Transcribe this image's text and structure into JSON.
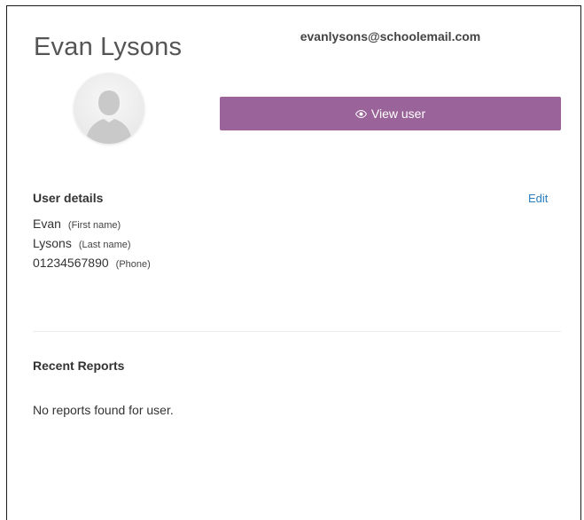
{
  "user": {
    "full_name": "Evan Lysons",
    "email": "evanlysons@schoolemail.com"
  },
  "actions": {
    "view_user_label": "View user",
    "edit_label": "Edit"
  },
  "details": {
    "title": "User details",
    "first_name": {
      "value": "Evan",
      "hint": "(First name)"
    },
    "last_name": {
      "value": "Lysons",
      "hint": "(Last name)"
    },
    "phone": {
      "value": "01234567890",
      "hint": "(Phone)"
    }
  },
  "reports": {
    "title": "Recent Reports",
    "empty_message": "No reports found for user."
  },
  "colors": {
    "button_bg": "#9a6399",
    "link": "#2a7fbf"
  },
  "icons": {
    "view": "eye-icon",
    "avatar": "user-silhouette"
  }
}
